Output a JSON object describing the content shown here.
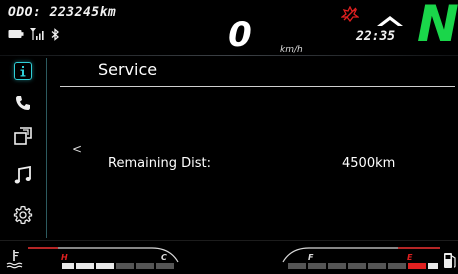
{
  "odometer": {
    "text": "ODO: 223245km"
  },
  "speed": {
    "value": "0",
    "unit": "km/h"
  },
  "clock": "22:35",
  "gear": "N",
  "sidebar": {
    "items": [
      {
        "name": "info",
        "active": true
      },
      {
        "name": "phone",
        "active": false
      },
      {
        "name": "screen-mirror",
        "active": false
      },
      {
        "name": "music",
        "active": false
      },
      {
        "name": "settings",
        "active": false
      }
    ]
  },
  "service": {
    "title": "Service",
    "back": "<",
    "remaining_label": "Remaining Dist:",
    "remaining_value": "4500km"
  },
  "temp_gauge": {
    "high": "H",
    "low": "C"
  },
  "fuel_gauge": {
    "full": "F",
    "empty": "E"
  },
  "colors": {
    "accent": "#2fd0d8",
    "gear": "#1ad64a",
    "warning": "#e02020"
  }
}
